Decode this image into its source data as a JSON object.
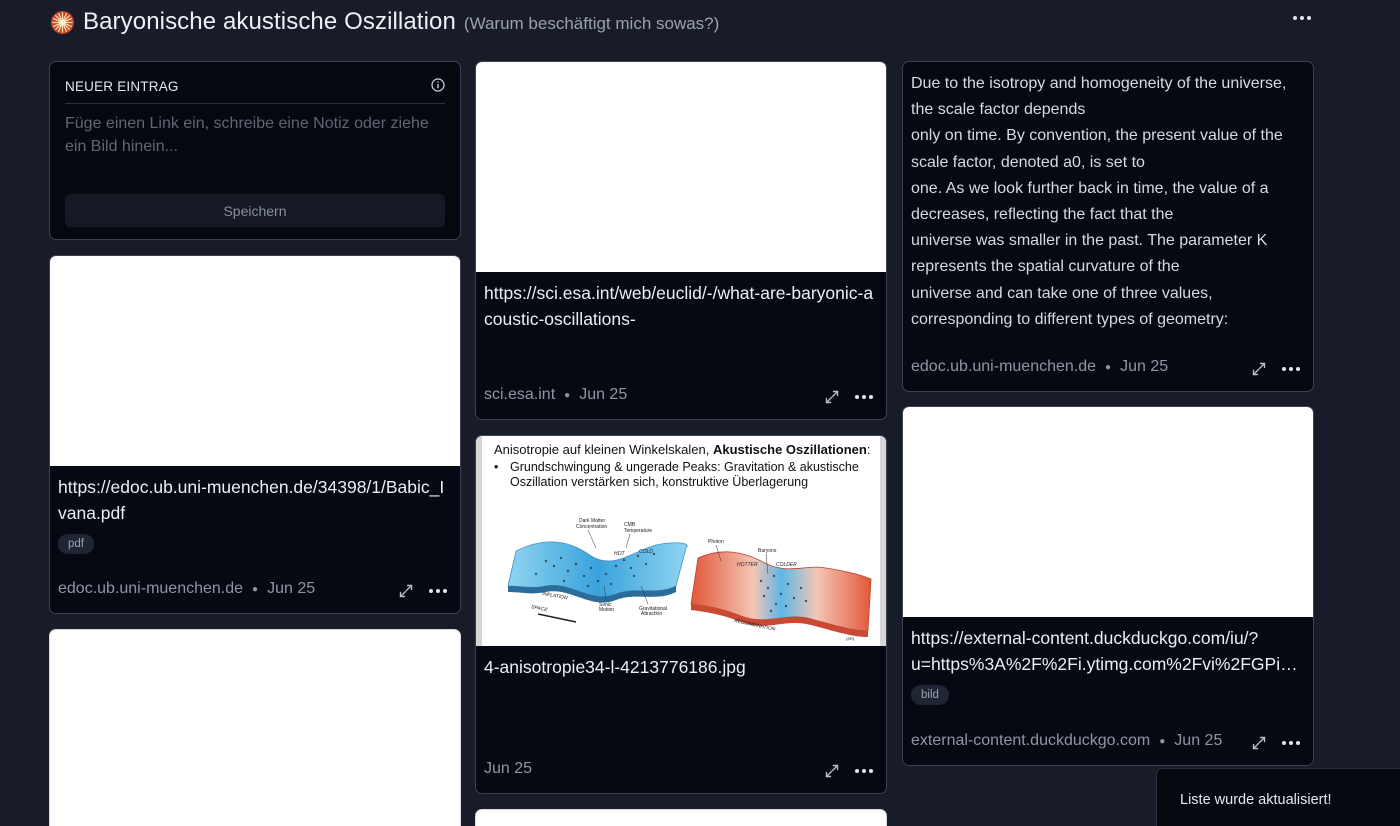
{
  "header": {
    "title": "Baryonische akustische Oszillation",
    "subtitle": "(Warum beschäftigt mich sowas?)",
    "logo_icon": "burst-logo-icon",
    "more_icon": "more-horizontal-icon"
  },
  "new_entry": {
    "label": "NEUER EINTRAG",
    "placeholder": "Füge einen Link ein, schreibe eine Notiz oder ziehe ein Bild hinein...",
    "save_label": "Speichern",
    "info_icon": "info-icon"
  },
  "cards": {
    "pdf": {
      "url": "https://edoc.ub.uni-muenchen.de/34398/1/Babic_Ivana.pdf",
      "tag": "pdf",
      "source": "edoc.ub.uni-muenchen.de",
      "date": "Jun 25"
    },
    "esa": {
      "url": "https://sci.esa.int/web/euclid/-/what-are-baryonic-acoustic-oscillations-",
      "source": "sci.esa.int",
      "date": "Jun 25"
    },
    "aniso": {
      "filename": "4-anisotropie34-l-4213776186.jpg",
      "date": "Jun 25",
      "slide": {
        "title_plain": "Anisotropie auf kleinen Winkelskalen, ",
        "title_bold": "Akustische Oszillationen",
        "title_end": ":",
        "bullet": "Grundschwingung & ungerade Peaks: Gravitation & akustische Oszillation verstärken sich, konstruktive Überlagerung",
        "labels": {
          "dark_matter": "Dark Matter Concentration",
          "cmb_temp": "CMB Temperature",
          "hot": "HOT",
          "cold": "COLD",
          "photon": "Photon",
          "baryons": "Baryons",
          "hotter": "HOTTER",
          "colder": "COLDER",
          "inflation": "INFLATION",
          "space": "SPACE",
          "sonic_motion": "Sonic Motion",
          "grav_attraction": "Gravitational Attraction",
          "recombination": "RECOMBINATION",
          "credit": "(SR)"
        }
      }
    },
    "note": {
      "lines": [
        "Due to the isotropy and homogeneity of the universe, the scale factor depends",
        "only on time. By convention, the present value of the scale factor, denoted a0, is set to",
        "one. As we look further back in time, the value of a decreases, reflecting the fact that the",
        "universe was smaller in the past. The parameter K represents the spatial curvature of the",
        "universe and can take one of three values, corresponding to different types of geometry:"
      ],
      "source": "edoc.ub.uni-muenchen.de",
      "date": "Jun 25"
    },
    "ddg": {
      "url": "https://external-content.duckduckgo.com/iu/?u=https%3A%2F%2Fi.ytimg.com%2Fvi%2FGPiQ...",
      "tag": "bild",
      "source": "external-content.duckduckgo.com",
      "date": "Jun 25"
    }
  },
  "toast": {
    "text": "Liste wurde aktualisiert!"
  },
  "icons": {
    "expand": "expand-icon",
    "more": "more-horizontal-icon"
  }
}
